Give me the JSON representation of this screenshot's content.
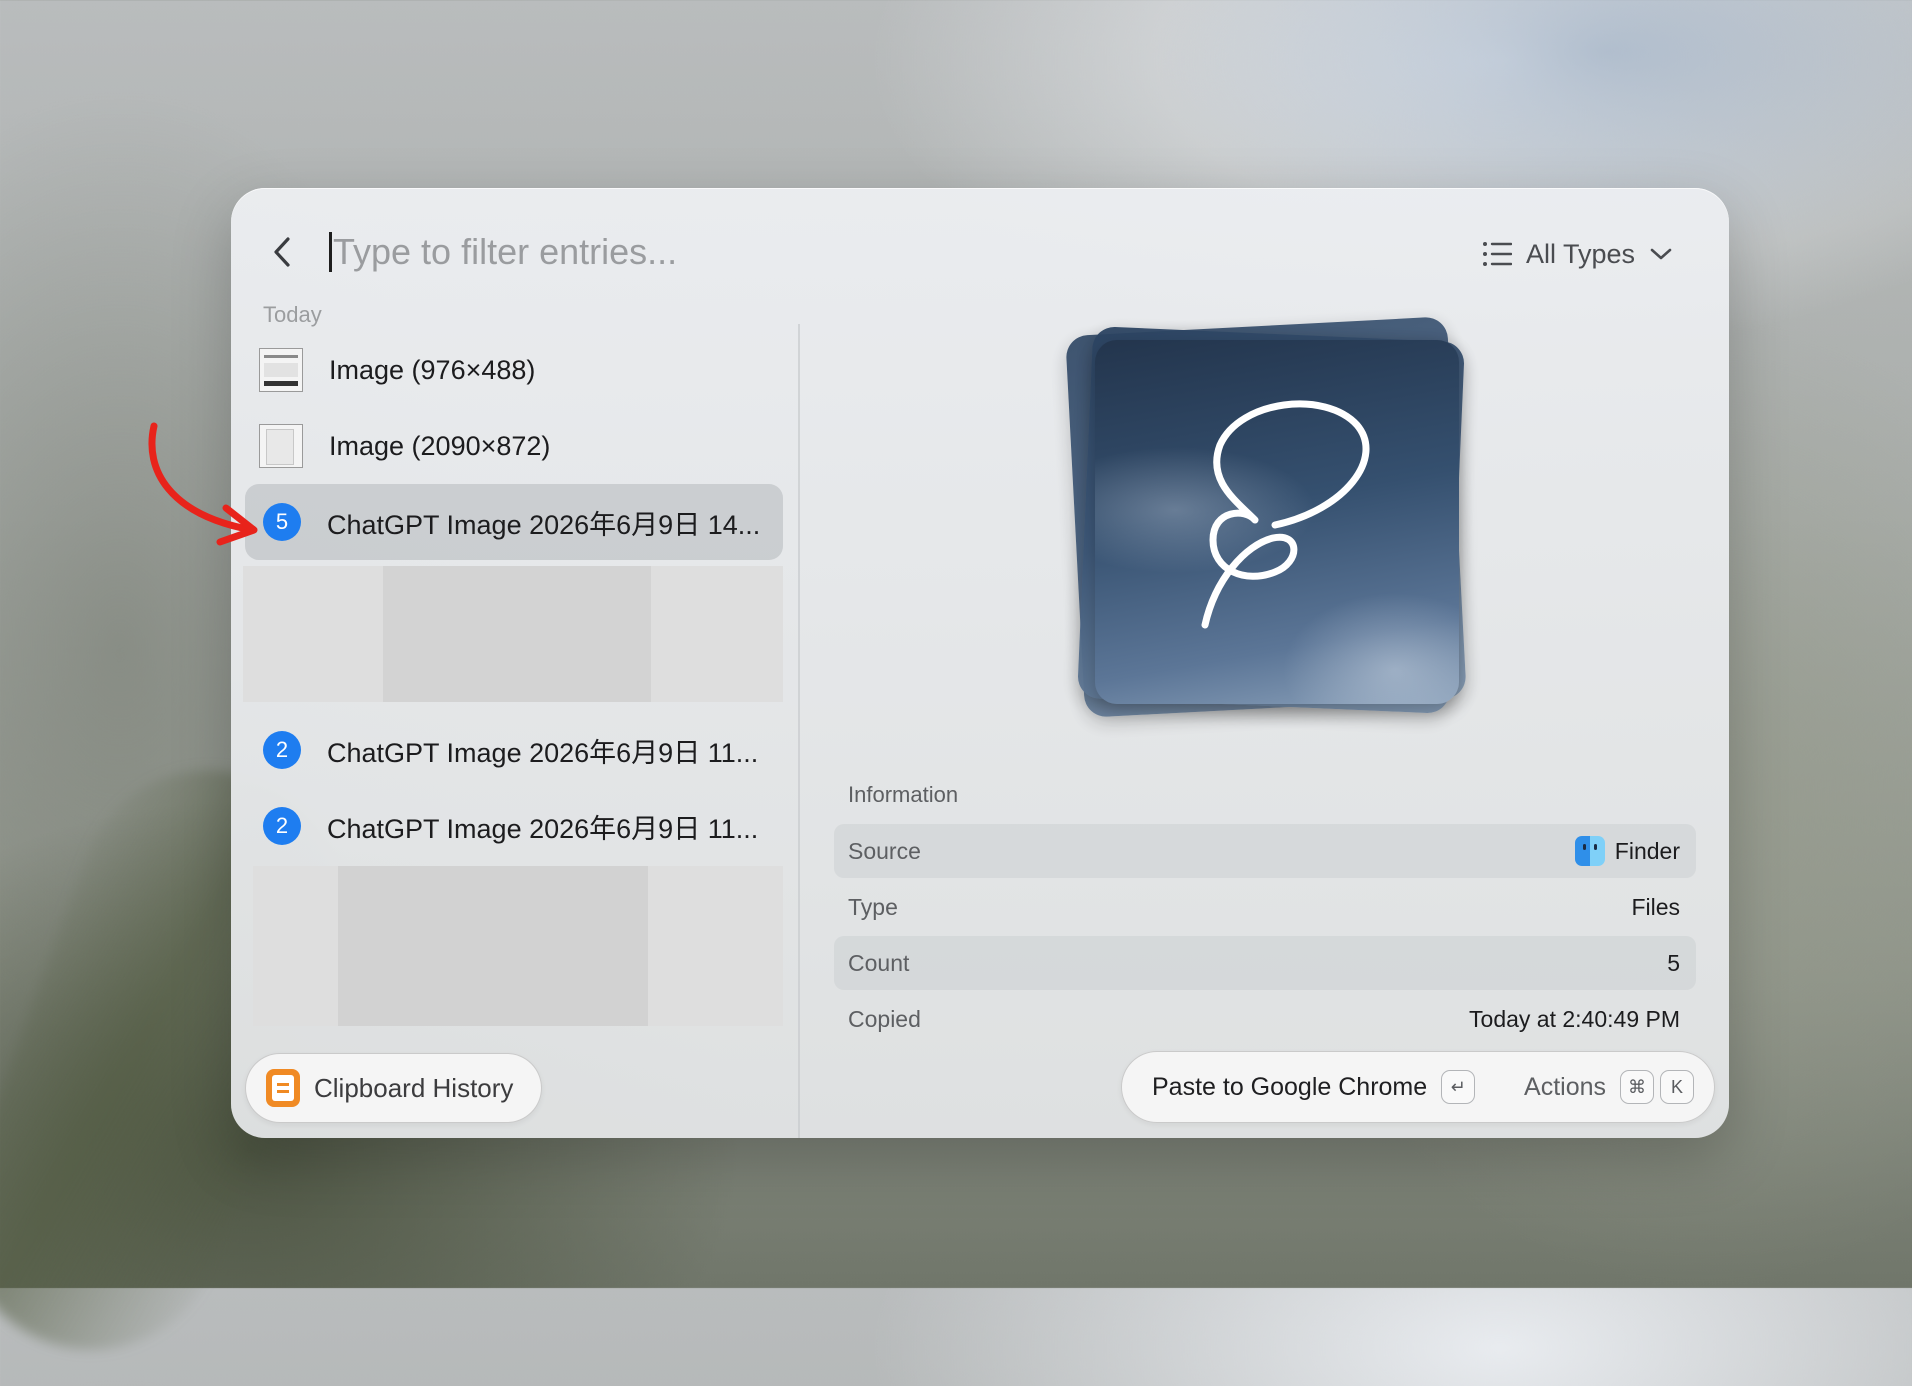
{
  "search": {
    "placeholder": "Type to filter entries...",
    "value": "",
    "back_icon": "chevron-left-icon"
  },
  "filter": {
    "label": "All Types",
    "icon": "list-icon",
    "dropdown_icon": "chevron-down-icon"
  },
  "list": {
    "section": "Today",
    "items": [
      {
        "kind": "image",
        "label": "Image (976×488)"
      },
      {
        "kind": "image",
        "label": "Image (2090×872)"
      },
      {
        "kind": "files",
        "count": "5",
        "label": "ChatGPT Image 2026年6月9日 14...",
        "selected": true
      },
      {
        "kind": "files",
        "count": "2",
        "label": "ChatGPT Image 2026年6月9日 11..."
      },
      {
        "kind": "files",
        "count": "2",
        "label": "ChatGPT Image 2026年6月9日 11..."
      }
    ]
  },
  "footer_left": {
    "label": "Clipboard History",
    "icon": "clipboard-icon"
  },
  "info": {
    "title": "Information",
    "rows": [
      {
        "key": "Source",
        "value": "Finder",
        "icon": "finder-icon"
      },
      {
        "key": "Type",
        "value": "Files"
      },
      {
        "key": "Count",
        "value": "5"
      },
      {
        "key": "Copied",
        "value": "Today at 2:40:49 PM"
      }
    ]
  },
  "actions": {
    "primary_label": "Paste to Google Chrome",
    "primary_key": "↵",
    "secondary_label": "Actions",
    "secondary_keys": [
      "⌘",
      "K"
    ]
  },
  "colors": {
    "accent": "#1e7df0",
    "annotation_arrow": "#e8231b",
    "clipboard_icon": "#f08a24"
  }
}
